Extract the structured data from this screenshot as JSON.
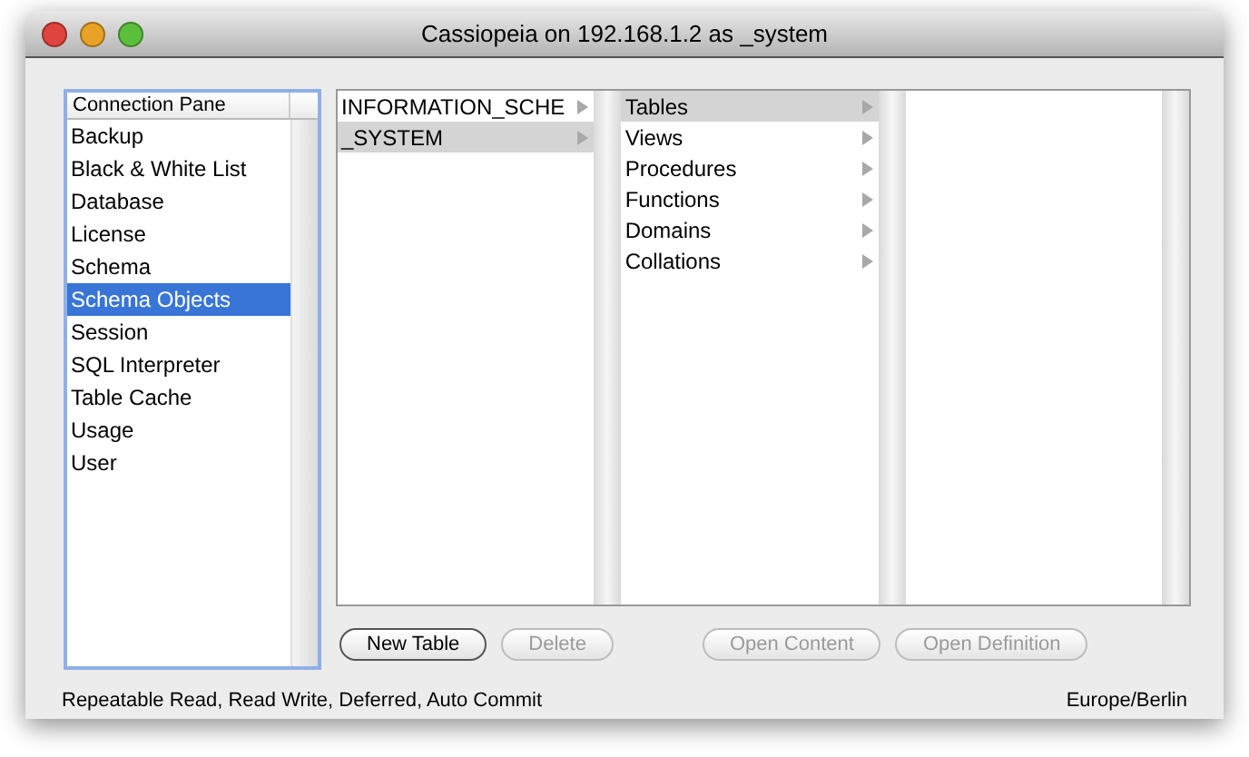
{
  "window": {
    "title": "Cassiopeia on 192.168.1.2 as _system"
  },
  "sidebar": {
    "header": "Connection Pane",
    "items": [
      {
        "label": "Backup",
        "selected": false
      },
      {
        "label": "Black & White List",
        "selected": false
      },
      {
        "label": "Database",
        "selected": false
      },
      {
        "label": "License",
        "selected": false
      },
      {
        "label": "Schema",
        "selected": false
      },
      {
        "label": "Schema Objects",
        "selected": true
      },
      {
        "label": "Session",
        "selected": false
      },
      {
        "label": "SQL Interpreter",
        "selected": false
      },
      {
        "label": "Table Cache",
        "selected": false
      },
      {
        "label": "Usage",
        "selected": false
      },
      {
        "label": "User",
        "selected": false
      }
    ]
  },
  "browser": {
    "columns": [
      [
        {
          "label": "INFORMATION_SCHE",
          "selected": false
        },
        {
          "label": "_SYSTEM",
          "selected": true
        }
      ],
      [
        {
          "label": "Tables",
          "selected": true
        },
        {
          "label": "Views",
          "selected": false
        },
        {
          "label": "Procedures",
          "selected": false
        },
        {
          "label": "Functions",
          "selected": false
        },
        {
          "label": "Domains",
          "selected": false
        },
        {
          "label": "Collations",
          "selected": false
        }
      ],
      []
    ]
  },
  "buttons": [
    {
      "label": "New Table",
      "disabled": false
    },
    {
      "label": "Delete",
      "disabled": true
    },
    {
      "label": "Open Content",
      "disabled": true
    },
    {
      "label": "Open Definition",
      "disabled": true
    }
  ],
  "status_bar": {
    "left": "Repeatable Read, Read Write, Deferred, Auto Commit",
    "right": "Europe/Berlin"
  }
}
